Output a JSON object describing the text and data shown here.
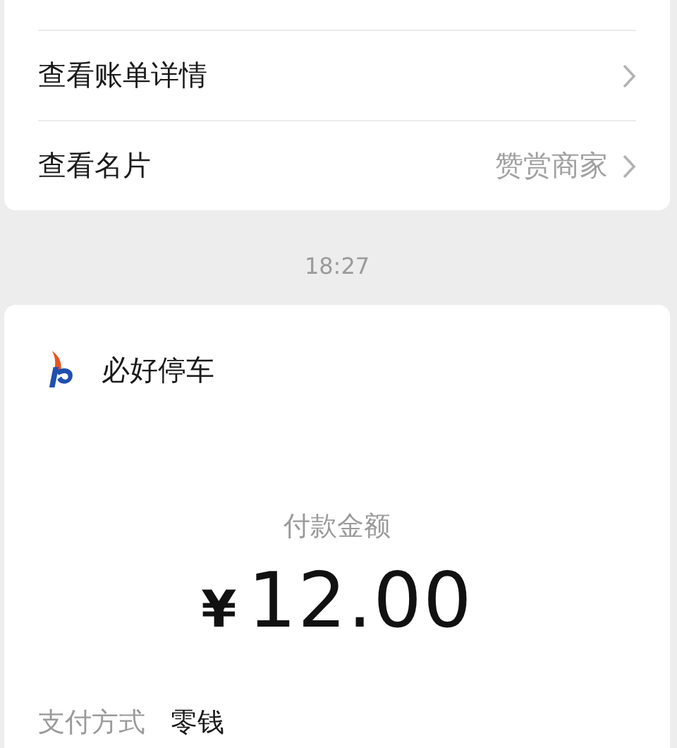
{
  "top_card": {
    "rows": [
      {
        "label": "查看账单详情"
      },
      {
        "label": "查看名片",
        "value": "赞赏商家"
      }
    ]
  },
  "timestamp": "18:27",
  "payment_card": {
    "merchant": "必好停车",
    "amount_label": "付款金额",
    "currency": "¥",
    "amount": "12.00",
    "details": [
      {
        "label": "支付方式",
        "value": "零钱"
      }
    ]
  }
}
